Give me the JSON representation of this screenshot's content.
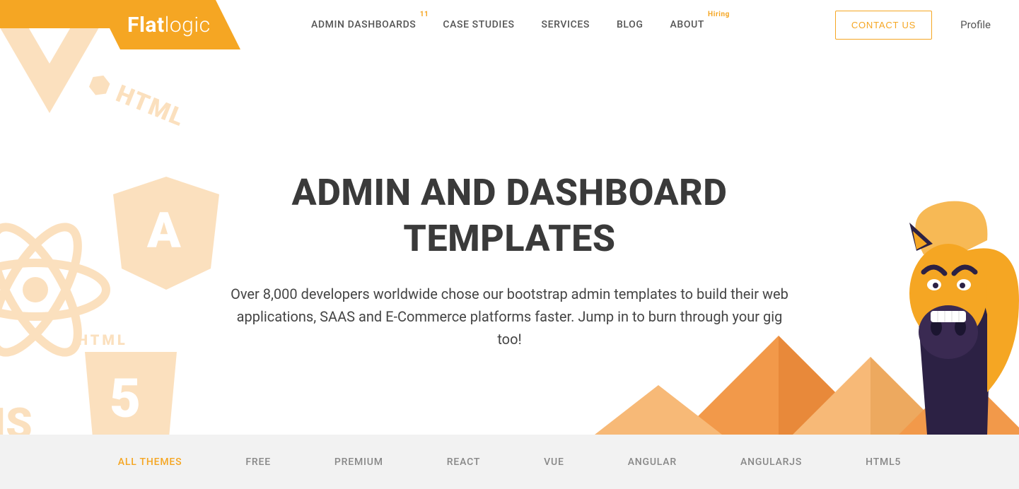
{
  "brand": {
    "bold": "Flat",
    "light": "logic"
  },
  "nav": {
    "items": [
      {
        "label": "ADMIN DASHBOARDS",
        "badge": "11"
      },
      {
        "label": "CASE STUDIES"
      },
      {
        "label": "SERVICES"
      },
      {
        "label": "BLOG"
      },
      {
        "label": "ABOUT",
        "badge_text": "Hiring"
      }
    ],
    "contact": "CONTACT US",
    "profile": "Profile"
  },
  "hero": {
    "title": "ADMIN AND DASHBOARD TEMPLATES",
    "subtitle": "Over 8,000 developers worldwide chose our bootstrap admin templates to build their web applications, SAAS and E-Commerce platforms faster. Jump in to burn through your gig too!"
  },
  "filters": {
    "items": [
      "ALL THEMES",
      "FREE",
      "PREMIUM",
      "REACT",
      "VUE",
      "ANGULAR",
      "ANGULARJS",
      "HTML5"
    ],
    "active": 0
  },
  "colors": {
    "accent": "#f5a623",
    "text_dark": "#3a3a3a",
    "filter_bg": "#f2f2f2"
  }
}
